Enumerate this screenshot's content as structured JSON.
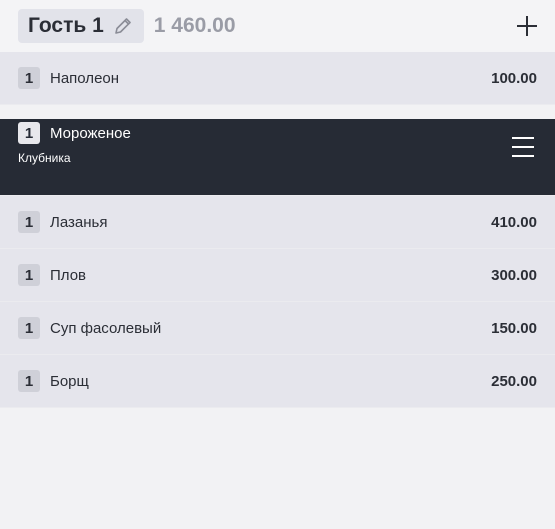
{
  "header": {
    "guest_name": "Гость 1",
    "guest_total": "1 460.00"
  },
  "items": [
    {
      "qty": "1",
      "name": "Наполеон",
      "price": "100.00"
    },
    {
      "qty": "1",
      "name": "Мороженое",
      "modifier": "Клубника",
      "selected": true
    },
    {
      "qty": "1",
      "name": "Лазанья",
      "price": "410.00"
    },
    {
      "qty": "1",
      "name": "Плов",
      "price": "300.00"
    },
    {
      "qty": "1",
      "name": "Суп фасолевый",
      "price": "150.00"
    },
    {
      "qty": "1",
      "name": "Борщ",
      "price": "250.00"
    }
  ],
  "icons": {
    "edit": "pencil-icon",
    "add": "plus-icon",
    "menu": "hamburger-menu-icon"
  }
}
